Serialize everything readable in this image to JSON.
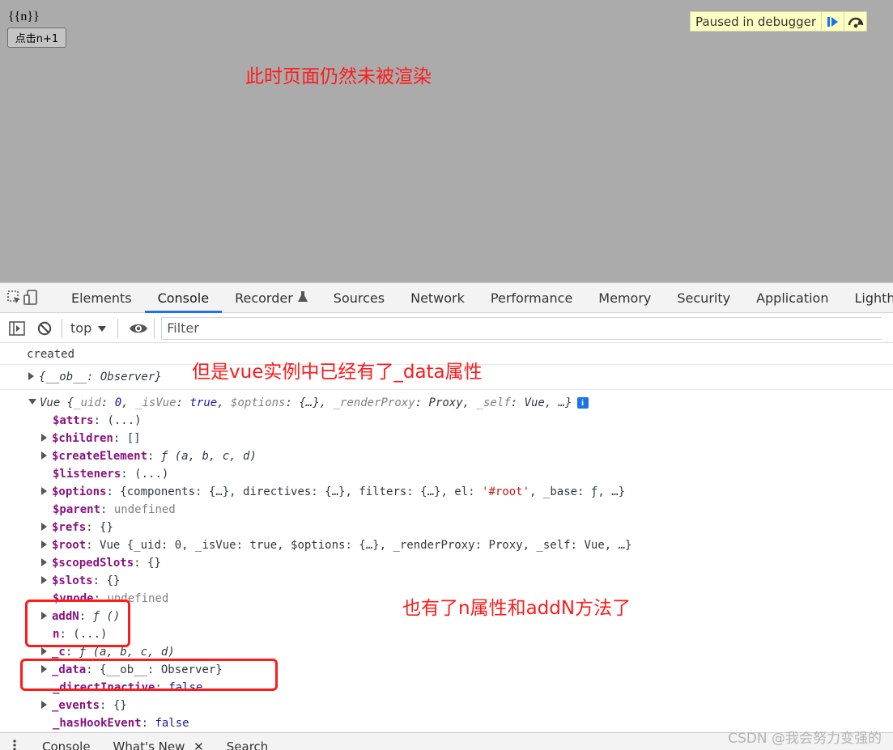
{
  "page": {
    "template_text": "{{n}}",
    "button_label": "点击n+1"
  },
  "debugger": {
    "paused_text": "Paused in debugger",
    "resume_icon": "resume-icon",
    "step_over_icon": "step-over-icon"
  },
  "annotations": {
    "not_rendered": "此时页面仍然未被渲染",
    "has_data": "但是vue实例中已经有了_data属性",
    "has_n_addN": "也有了n属性和addN方法了",
    "color": "#ff1a1a"
  },
  "devtools": {
    "tabs": [
      "Elements",
      "Console",
      "Recorder",
      "Sources",
      "Network",
      "Performance",
      "Memory",
      "Security",
      "Application",
      "Lighthouse"
    ],
    "active_tab": "Console",
    "accent": "#1a73e8"
  },
  "console_toolbar": {
    "context": "top",
    "filter_placeholder": "Filter"
  },
  "console": {
    "created": "created",
    "ob_summary": "{__ob__: Observer}",
    "vue_summary": {
      "prefix": "Vue {",
      "uid_key": "_uid",
      "uid_val": "0",
      "isvue_key": "_isVue",
      "isvue_val": "true",
      "options_key": "$options",
      "options_val": "{…}",
      "proxy_key": "_renderProxy",
      "proxy_val": "Proxy",
      "self_key": "_self",
      "self_val": "Vue",
      "suffix": "…}"
    },
    "props": [
      {
        "key": "$attrs",
        "value": "(...)",
        "expandable": false
      },
      {
        "key": "$children",
        "value": "[]",
        "expandable": true
      },
      {
        "key": "$createElement",
        "value": "ƒ (a, b, c, d)",
        "expandable": true
      },
      {
        "key": "$listeners",
        "value": "(...)",
        "expandable": false
      },
      {
        "key": "$options",
        "value": "{components: {…}, directives: {…}, filters: {…}, el: '#root', _base: ƒ, …}",
        "expandable": true
      },
      {
        "key": "$parent",
        "value": "undefined",
        "expandable": false
      },
      {
        "key": "$refs",
        "value": "{}",
        "expandable": true
      },
      {
        "key": "$root",
        "value": "Vue {_uid: 0, _isVue: true, $options: {…}, _renderProxy: Proxy, _self: Vue, …}",
        "expandable": true
      },
      {
        "key": "$scopedSlots",
        "value": "{}",
        "expandable": true
      },
      {
        "key": "$slots",
        "value": "{}",
        "expandable": true
      },
      {
        "key": "$vnode",
        "value": "undefined",
        "expandable": false
      },
      {
        "key": "addN",
        "value": "ƒ ()",
        "expandable": true
      },
      {
        "key": "n",
        "value": "(...)",
        "expandable": false
      },
      {
        "key": "_c",
        "value": "ƒ (a, b, c, d)",
        "expandable": true
      },
      {
        "key": "_data",
        "value": "{__ob__: Observer}",
        "expandable": true
      },
      {
        "key": "_directInactive",
        "value": "false",
        "expandable": false
      },
      {
        "key": "_events",
        "value": "{}",
        "expandable": true
      },
      {
        "key": "_hasHookEvent",
        "value": "false",
        "expandable": false
      }
    ],
    "options_el_value": "'#root'"
  },
  "drawer": {
    "tabs": [
      "Console",
      "What's New",
      "Search"
    ]
  },
  "watermark": "CSDN @我会努力变强的"
}
